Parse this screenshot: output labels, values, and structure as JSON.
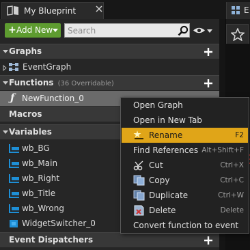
{
  "tabs": {
    "active_tab_label": "My Blueprint",
    "right_tab_label": "E"
  },
  "toolbar": {
    "add_new_label": "Add New",
    "search_placeholder": "Search"
  },
  "sections": {
    "graphs": {
      "title": "Graphs",
      "items": [
        "EventGraph"
      ]
    },
    "functions": {
      "title": "Functions",
      "note": "(36 Overridable)",
      "items": [
        "NewFunction_0"
      ]
    },
    "macros": {
      "title": "Macros"
    },
    "variables": {
      "title": "Variables",
      "items": [
        "wb_BG",
        "wb_Main",
        "wb_Right",
        "wb_Title",
        "wb_Wrong",
        "WidgetSwitcher_0"
      ]
    },
    "event_dispatchers": {
      "title": "Event Dispatchers"
    }
  },
  "context_menu": {
    "items": [
      {
        "label": "Open Graph",
        "shortcut": ""
      },
      {
        "label": "Open in New Tab",
        "shortcut": ""
      },
      {
        "label": "Rename",
        "shortcut": "F2",
        "icon": "rename-icon",
        "highlighted": true
      },
      {
        "label": "Find References",
        "shortcut": "Alt+Shift+F"
      },
      {
        "label": "Cut",
        "shortcut": "Ctrl+X",
        "icon": "scissors-icon"
      },
      {
        "label": "Copy",
        "shortcut": "Ctrl+C",
        "icon": "copy-icon"
      },
      {
        "label": "Duplicate",
        "shortcut": "Ctrl+W",
        "icon": "duplicate-icon"
      },
      {
        "label": "Delete",
        "shortcut": "Delete",
        "icon": "delete-icon"
      },
      {
        "label": "Convert function to event",
        "shortcut": ""
      }
    ]
  },
  "colors": {
    "accent_green": "#5e9c30",
    "highlight": "#e0a518",
    "variable_icon": "#1e8fd6"
  }
}
